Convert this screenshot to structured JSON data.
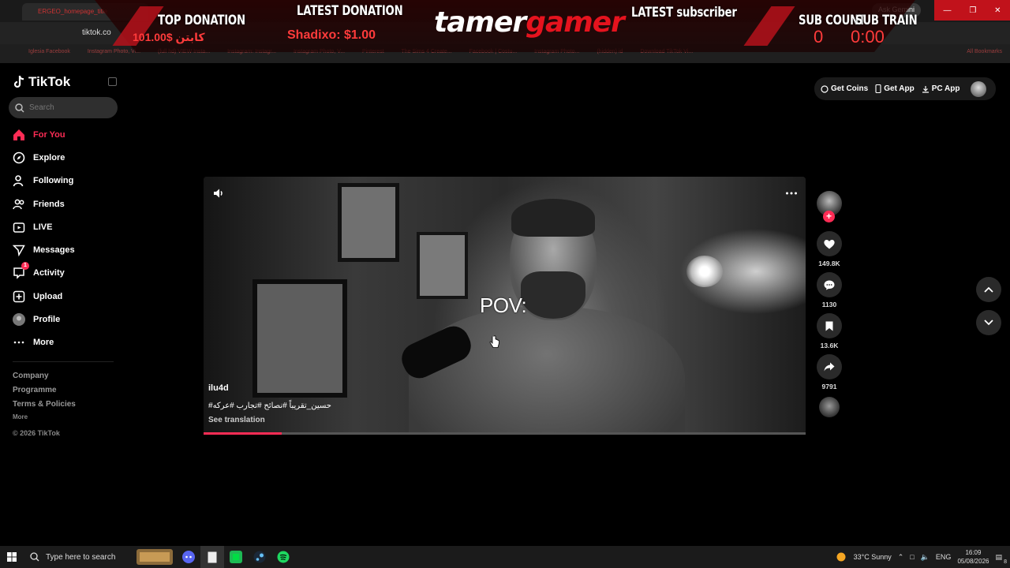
{
  "browser": {
    "tab_title": "ERGEO_homepage_title",
    "address": "tiktok.co",
    "ask_gemini": "Ask Gemini",
    "bookmarks": [
      "Iglesia Facebook",
      "Instagram Photo, Vi...",
      "(full hd) VIEW Insta...",
      "Instagram: Instagr...",
      "Instagram Photo, V...",
      "Pinterest",
      "The Sims 4 Create...",
      "Facebook | Costu...",
      "Instagram Photo...",
      "(hidden) id",
      "Download TikTok Vi..."
    ],
    "all_bookmarks": "All Bookmarks"
  },
  "overlay": {
    "top_donation_label": "TOP DONATION",
    "top_donation_value": "101.00$ كابتن",
    "latest_donation_label": "LATEST DONATION",
    "latest_donation_value": "Shadixo: $1.00",
    "brand_a": "tamer",
    "brand_b": "gamer",
    "latest_subscriber_label": "LATEST subscriber",
    "sub_count_label": "SUB COUNT",
    "sub_count_value": "0",
    "sub_train_label": "SUB TRAIN",
    "sub_train_value": "0:00"
  },
  "sidebar": {
    "logo": "TikTok",
    "search_placeholder": "Search",
    "items": [
      {
        "label": "For You",
        "icon": "home-icon"
      },
      {
        "label": "Explore",
        "icon": "compass-icon"
      },
      {
        "label": "Following",
        "icon": "person-icon"
      },
      {
        "label": "Friends",
        "icon": "people-icon"
      },
      {
        "label": "LIVE",
        "icon": "live-icon"
      },
      {
        "label": "Messages",
        "icon": "send-icon"
      },
      {
        "label": "Activity",
        "icon": "inbox-icon",
        "badge": "1"
      },
      {
        "label": "Upload",
        "icon": "plus-box-icon"
      },
      {
        "label": "Profile",
        "icon": "avatar-icon"
      },
      {
        "label": "More",
        "icon": "ellipsis-icon"
      }
    ],
    "footer": [
      "Company",
      "Programme",
      "Terms & Policies"
    ],
    "footer_more": "More",
    "copyright": "© 2026 TikTok"
  },
  "header": {
    "get_coins": "Get Coins",
    "get_app": "Get App",
    "pc_app": "PC App"
  },
  "video": {
    "overlay_text": "POV:",
    "author": "ilu4d",
    "description": "#حسين_تقريباً #نصائح #تجارب #عركه",
    "see_translation": "See translation",
    "progress": 0.13
  },
  "actions": {
    "likes": "149.8K",
    "comments": "1130",
    "saves": "13.6K",
    "shares": "9791"
  },
  "taskbar": {
    "search_placeholder": "Type here to search",
    "weather": "33°C  Sunny",
    "lang": "ENG",
    "time": "16:09",
    "date": "05/08/2026",
    "notifications": "8"
  },
  "colors": {
    "accent": "#fe2c55",
    "overlay_red": "#e5131e"
  }
}
